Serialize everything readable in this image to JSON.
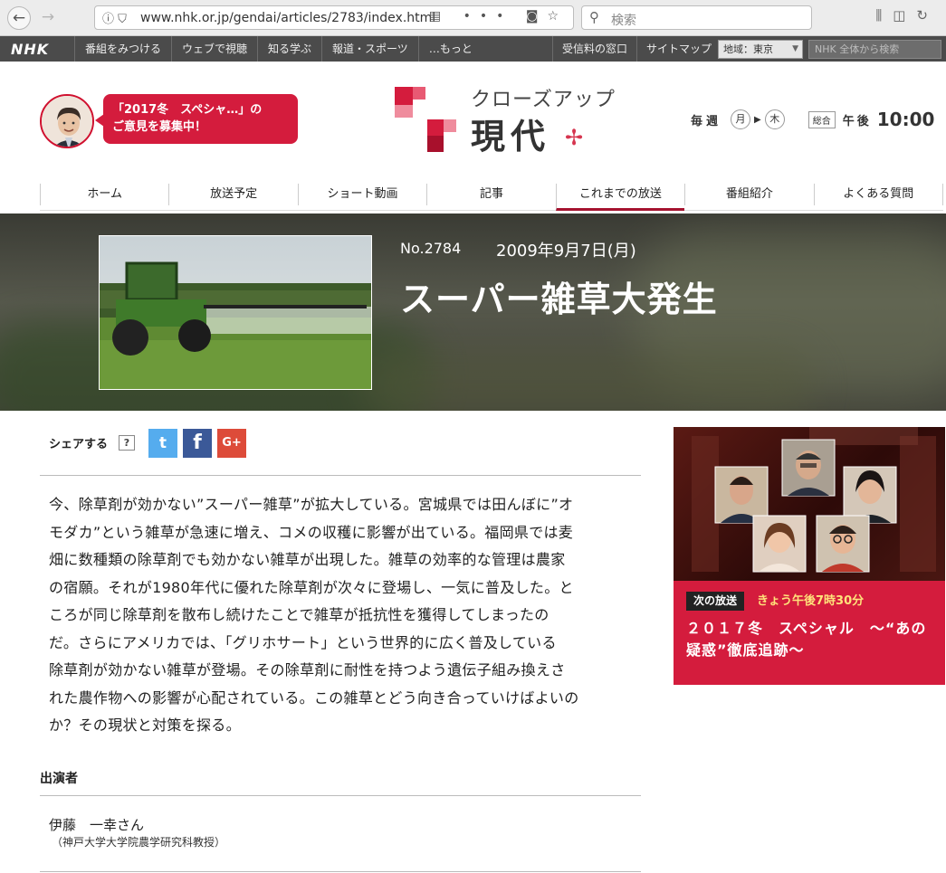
{
  "browser": {
    "url": "www.nhk.or.jp/gendai/articles/2783/index.html",
    "search_placeholder": "検索"
  },
  "nhk_bar": {
    "logo": "NHK",
    "links": [
      "番組をみつける",
      "ウェブで視聴",
      "知る学ぶ",
      "報道・スポーツ",
      "…もっと"
    ],
    "right_links": [
      "受信料の窓口",
      "サイトマップ"
    ],
    "region": "地域：東京",
    "search_placeholder": "NHK 全体から検索"
  },
  "header": {
    "speech": "「2017冬　スペシャ…」の\nご意見を募集中！",
    "logo_top": "クローズアップ",
    "logo_main": "現代",
    "schedule": {
      "prefix": "毎週",
      "day_from": "月",
      "arrow": "▶",
      "day_to": "木",
      "channel": "総合",
      "ampm": "午後",
      "time": "10:00"
    }
  },
  "tabs": [
    "ホーム",
    "放送予定",
    "ショート動画",
    "記事",
    "これまでの放送",
    "番組紹介",
    "よくある質問"
  ],
  "active_tab": "これまでの放送",
  "episode": {
    "number": "No.2784",
    "date": "2009年9月7日(月)",
    "title": "スーパー雑草大発生"
  },
  "share": {
    "label": "シェアする",
    "help": "?",
    "twitter": "t",
    "facebook": "f",
    "google": "G+"
  },
  "summary_lines": [
    "今、除草剤が効かない”スーパー雑草”が拡大している。宮城県では田んぼに”オ",
    "モダカ”という雑草が急速に増え、コメの収穫に影響が出ている。福岡県では麦",
    "畑に数種類の除草剤でも効かない雑草が出現した。雑草の効率的な管理は農家",
    "の宿願。それが1980年代に優れた除草剤が次々に登場し、一気に普及した。と",
    "ころが同じ除草剤を散布し続けたことで雑草が抵抗性を獲得してしまったの",
    "だ。さらにアメリカでは、「グリホサート」という世界的に広く普及している",
    "除草剤が効かない雑草が登場。その除草剤に耐性を持つよう遺伝子組み換えさ",
    "れた農作物への影響が心配されている。この雑草とどう向き合っていけばよいの",
    "か？その現状と対策を探る。"
  ],
  "cast": {
    "heading": "出演者",
    "name": "伊藤　一幸さん",
    "affiliation": "（神戸大学大学院農学研究科教授）"
  },
  "sidebar": {
    "next_label": "次の放送",
    "next_time": "きょう午後7時30分",
    "next_title": "２０１７冬　スペシャル　～“あの疑惑”徹底追跡～"
  },
  "colors": {
    "accent": "#d41c3d",
    "active_tab_underline": "#a5122f",
    "nhk_bar": "#4b4b4b"
  }
}
